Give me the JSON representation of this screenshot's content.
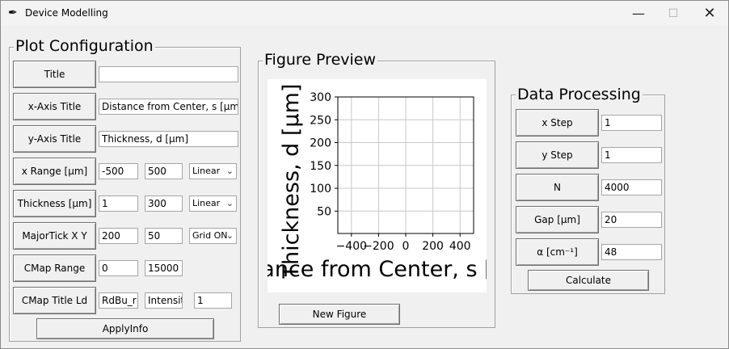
{
  "window": {
    "title": "Device Modelling"
  },
  "plot_config": {
    "legend": "Plot Configuration",
    "rows": [
      {
        "label": "Title",
        "fields": [
          ""
        ]
      },
      {
        "label": "x-Axis Title",
        "fields": [
          "Distance from Center, s [µm]"
        ]
      },
      {
        "label": "y-Axis Title",
        "fields": [
          "Thickness, d [µm]"
        ]
      },
      {
        "label": "x Range [µm]",
        "fields": [
          "-500",
          "500"
        ],
        "combo": "Linear"
      },
      {
        "label": "Thickness [µm]",
        "fields": [
          "1",
          "300"
        ],
        "combo": "Linear"
      },
      {
        "label": "MajorTick X Y",
        "fields": [
          "200",
          "50"
        ],
        "combo": "Grid ON"
      },
      {
        "label": "CMap Range",
        "fields": [
          "0",
          "15000"
        ]
      },
      {
        "label": "CMap Title Ld",
        "fields": [
          "RdBu_r",
          "Intensit",
          "1"
        ]
      }
    ],
    "apply_label": "ApplyInfo"
  },
  "figure_preview": {
    "legend": "Figure Preview",
    "new_figure_label": "New Figure"
  },
  "data_processing": {
    "legend": "Data Processing",
    "rows": [
      {
        "label": "x Step",
        "value": "1"
      },
      {
        "label": "y Step",
        "value": "1"
      },
      {
        "label": "N",
        "value": "4000"
      },
      {
        "label": "Gap [µm]",
        "value": "20"
      },
      {
        "label": "α [cm⁻¹]",
        "value": "48"
      }
    ],
    "calculate_label": "Calculate"
  },
  "chart_data": {
    "type": "line",
    "series": [],
    "xlabel": "Distance from Center, s [µm]",
    "ylabel": "Thickness, d [µm]",
    "xlim": [
      -500,
      500
    ],
    "ylim": [
      1,
      300
    ],
    "xticks": [
      -400,
      -200,
      0,
      200,
      400
    ],
    "yticks": [
      50,
      100,
      150,
      200,
      250,
      300
    ],
    "grid": true
  }
}
